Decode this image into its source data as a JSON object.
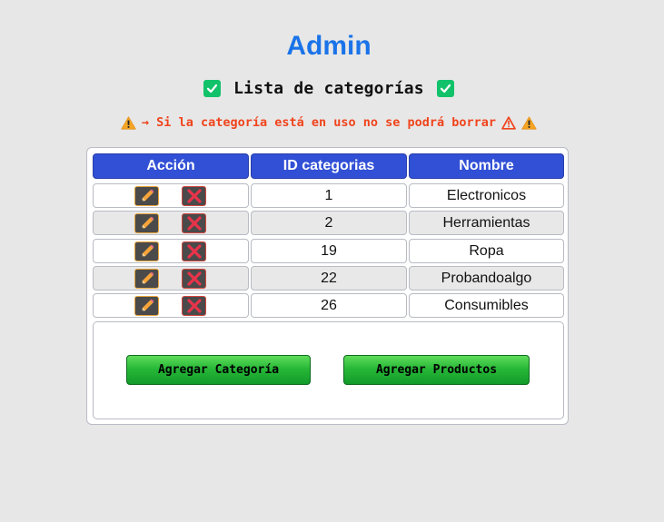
{
  "header": {
    "title": "Admin",
    "subtitle": "Lista de categorías",
    "warning": "→ Si la categoría está en uso no se podrá borrar"
  },
  "table": {
    "columns": [
      "Acción",
      "ID categorias",
      "Nombre"
    ],
    "rows": [
      {
        "id": "1",
        "nombre": "Electronicos"
      },
      {
        "id": "2",
        "nombre": "Herramientas"
      },
      {
        "id": "19",
        "nombre": "Ropa"
      },
      {
        "id": "22",
        "nombre": "Probandoalgo"
      },
      {
        "id": "26",
        "nombre": "Consumibles"
      }
    ]
  },
  "actions": {
    "add_category_label": "Agregar Categoría",
    "add_products_label": "Agregar Productos"
  },
  "icons": {
    "subtitle_left": "checkmark-icon",
    "subtitle_right": "checkmark-icon",
    "warning_left": "warning-icon",
    "warning_inline": "warning-outline-icon",
    "warning_right": "warning-icon",
    "edit": "pencil-icon",
    "delete": "cross-icon"
  },
  "colors": {
    "title": "#1a73e8",
    "header_bg": "#3150d6",
    "warning_text": "#f0441c",
    "check_bg": "#12c26b",
    "button_green": "#28b838"
  }
}
